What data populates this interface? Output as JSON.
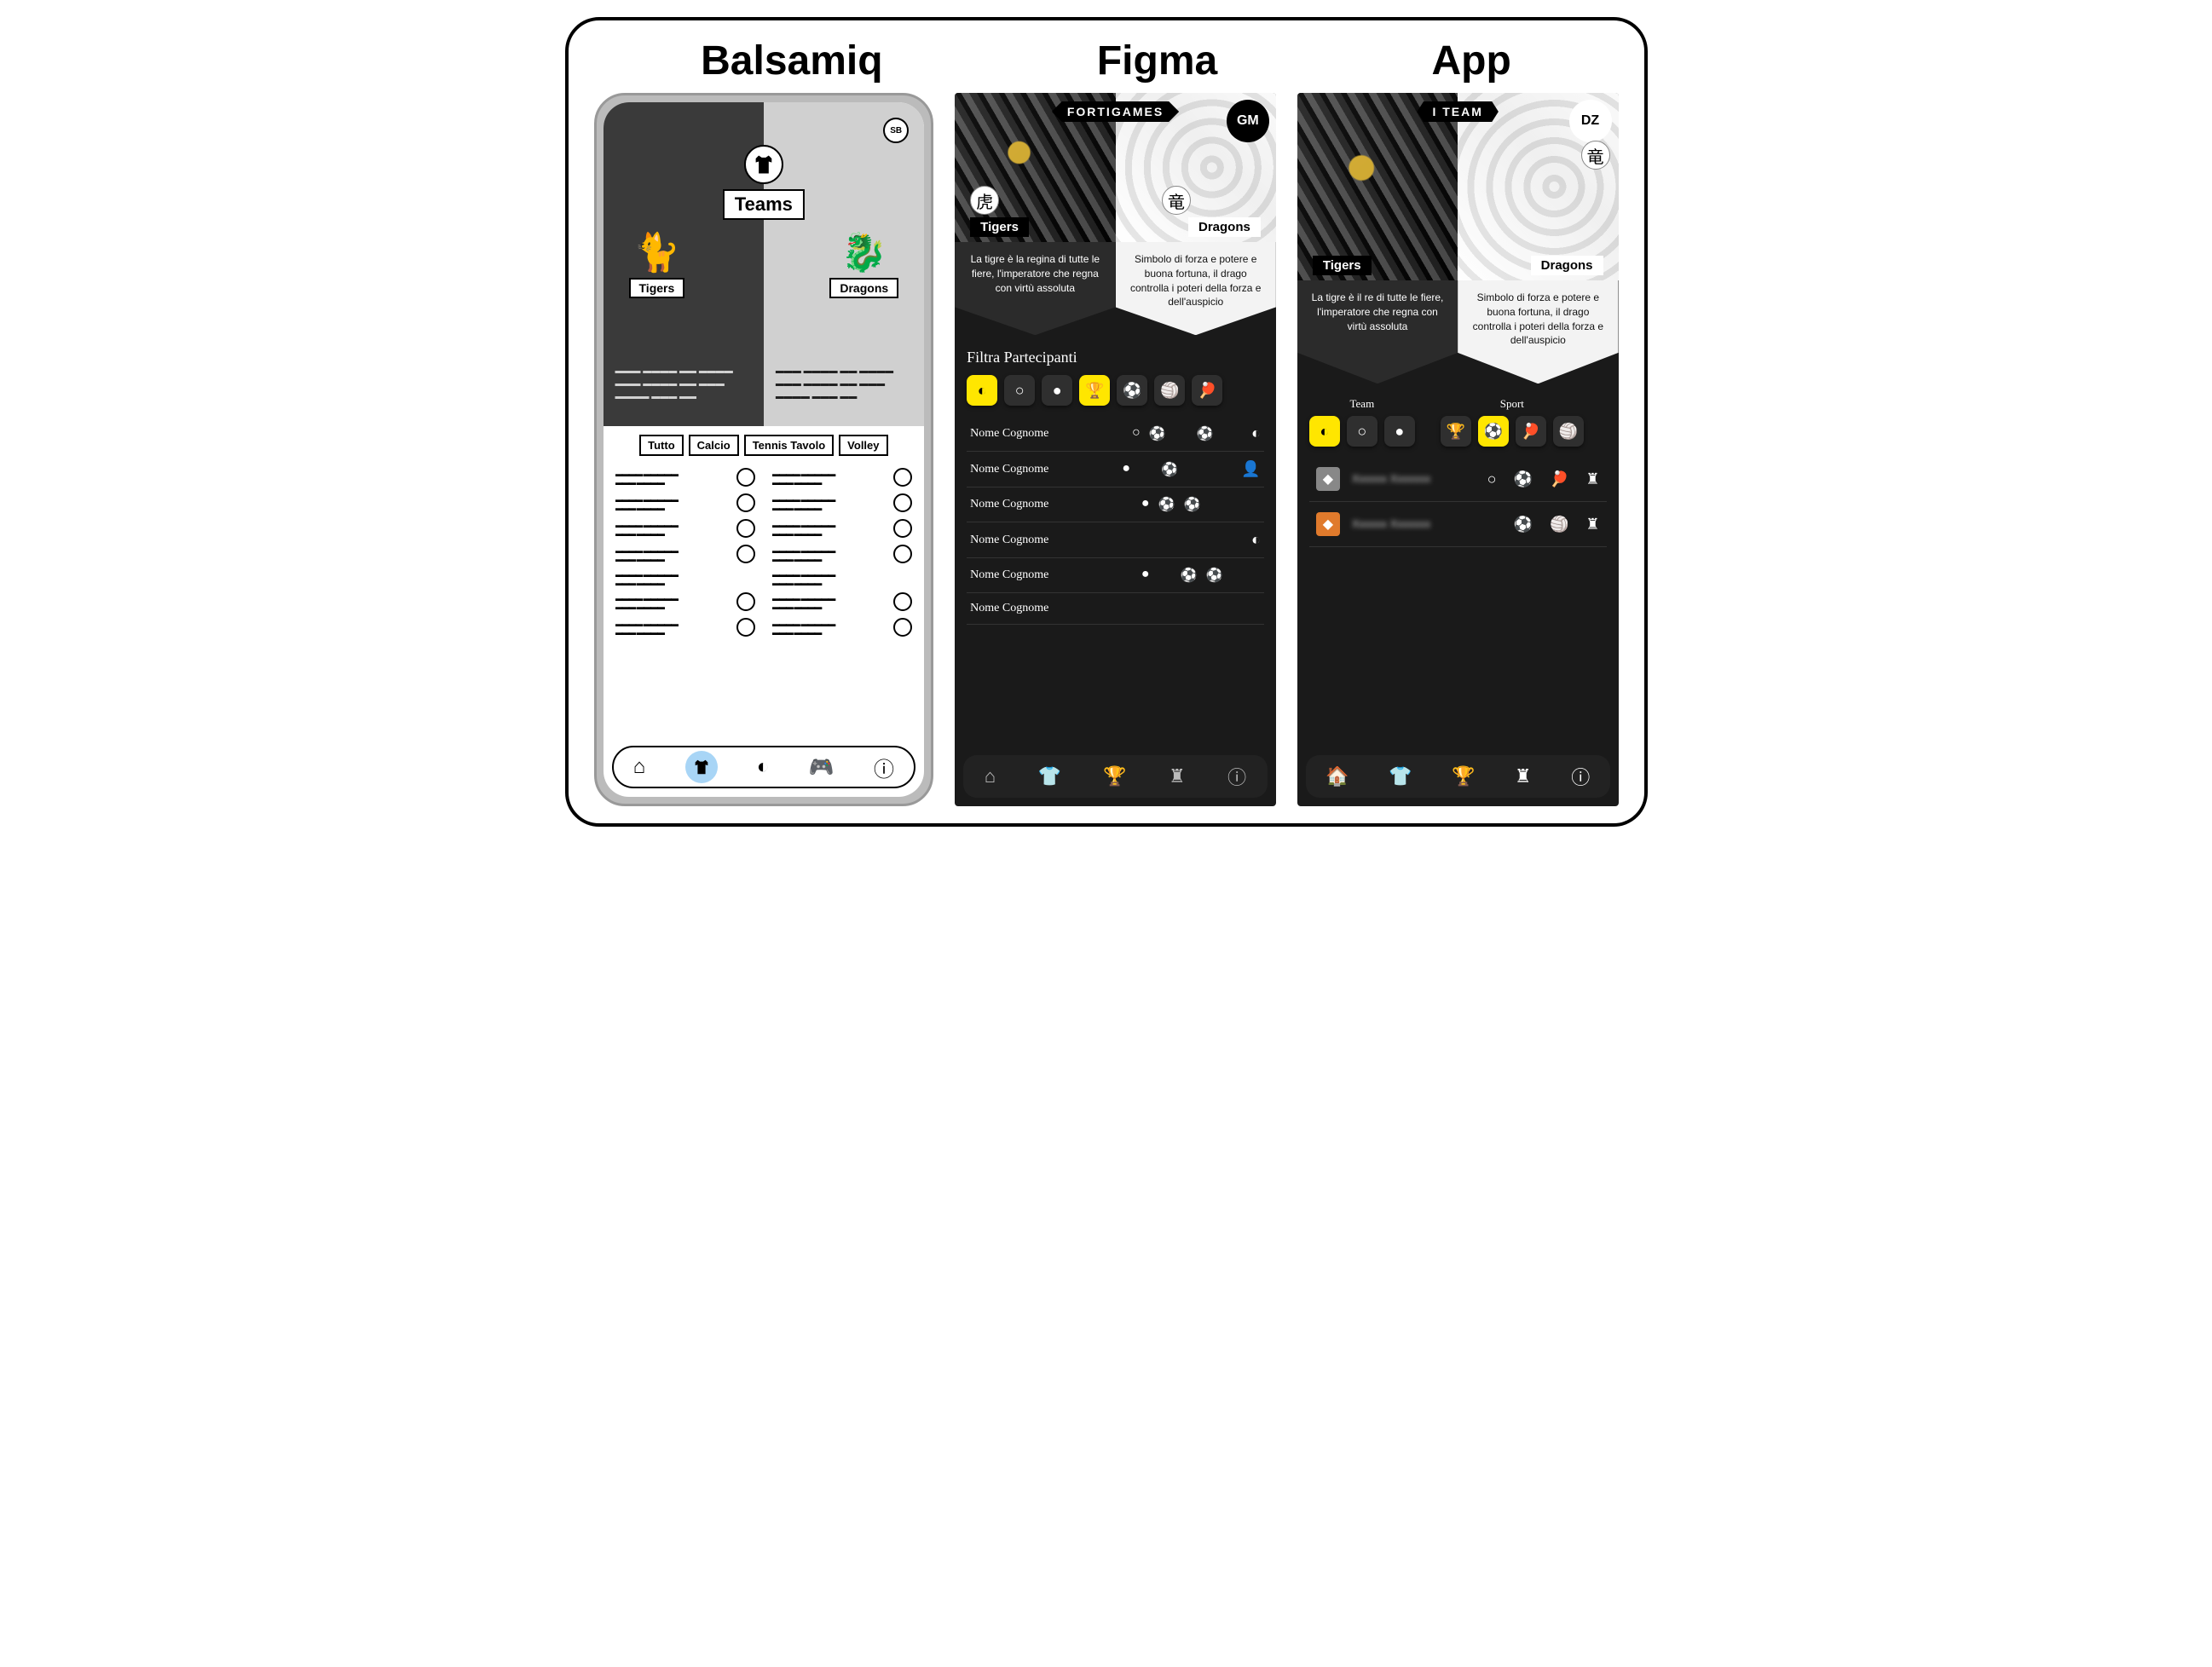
{
  "titles": [
    "Balsamiq",
    "Figma",
    "App"
  ],
  "balsamiq": {
    "profile_initials": "SB",
    "title": "Teams",
    "team_left": "Tigers",
    "team_right": "Dragons",
    "filters": [
      "Tutto",
      "Calcio",
      "Tennis Tavolo",
      "Volley"
    ],
    "nav_icons": [
      "home-icon",
      "jersey-icon",
      "whistle-icon",
      "gamepad-icon",
      "info-icon"
    ],
    "active_nav_index": 1,
    "list_rows_per_column": 7
  },
  "figma": {
    "ribbon": "FORTIGAMES",
    "badge": "GM",
    "kanji_left": "虎",
    "kanji_right": "竜",
    "team_left": "Tigers",
    "team_right": "Dragons",
    "desc_left": "La tigre è la regina di tutte le fiere, l'imperatore che regna con virtù assoluta",
    "desc_right": "Simbolo di forza e potere e buona fortuna, il drago controlla i poteri della forza e dell'auspicio",
    "filter_title": "Filtra Partecipanti",
    "filter_icons": [
      "half-circle-icon",
      "ring-icon",
      "dot-icon",
      "trophy-icon",
      "soccer-icon",
      "volleyball-icon",
      "pingpong-icon"
    ],
    "filter_active": [
      0,
      3
    ],
    "rows": [
      {
        "name": "Nome Cognome",
        "marks": [
          "○",
          "⚽",
          "",
          "⚽"
        ],
        "tail": "whistle"
      },
      {
        "name": "Nome Cognome",
        "marks": [
          "●",
          "",
          "⚽",
          ""
        ],
        "tail": "person"
      },
      {
        "name": "Nome Cognome",
        "marks": [
          "●",
          "⚽",
          "⚽",
          ""
        ],
        "tail": ""
      },
      {
        "name": "Nome Cognome",
        "marks": [
          "",
          "",
          "",
          ""
        ],
        "tail": "whistle"
      },
      {
        "name": "Nome Cognome",
        "marks": [
          "●",
          "",
          "⚽",
          "⚽"
        ],
        "tail": ""
      },
      {
        "name": "Nome Cognome",
        "marks": [
          "",
          "",
          "",
          ""
        ],
        "tail": ""
      }
    ],
    "nav_icons": [
      "home-icon",
      "shirt-icon",
      "trophy-icon",
      "rook-icon",
      "info-icon"
    ],
    "active_nav_index": 2
  },
  "app": {
    "ribbon": "I TEAM",
    "badge": "DZ",
    "kanji": "竜",
    "team_left": "Tigers",
    "team_right": "Dragons",
    "desc_left": "La tigre è il re di tutte le fiere, l'imperatore che regna con virtù assoluta",
    "desc_right": "Simbolo di forza e potere e buona fortuna, il drago controlla i poteri della forza e dell'auspicio",
    "group_team_label": "Team",
    "group_sport_label": "Sport",
    "team_filter_icons": [
      "half-circle-icon",
      "ring-icon",
      "dot-icon"
    ],
    "team_filter_active": 0,
    "sport_filter_icons": [
      "trophy-icon",
      "soccer-icon",
      "pingpong-icon",
      "volleyball-icon"
    ],
    "sport_filter_active": 1,
    "rows": [
      {
        "avatar_color": "#888",
        "name": "Xxxxxx Xxxxxxx",
        "icons": [
          "○",
          "⚽",
          "🏓",
          "♜"
        ]
      },
      {
        "avatar_color": "#e07a2c",
        "name": "Xxxxxx Xxxxxxx",
        "icons": [
          "",
          "⚽",
          "🏐",
          "♜"
        ]
      }
    ],
    "nav_icons": [
      "home-icon",
      "shirt-icon",
      "trophy-icon",
      "rook-icon",
      "info-icon"
    ],
    "active_nav_index": 1
  }
}
